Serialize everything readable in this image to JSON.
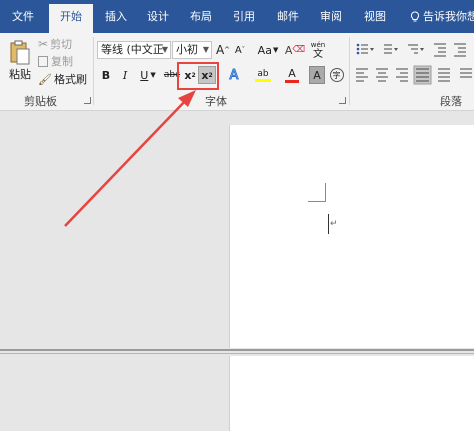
{
  "tabs": [
    {
      "label": "文件",
      "active": false
    },
    {
      "label": "开始",
      "active": true
    },
    {
      "label": "插入",
      "active": false
    },
    {
      "label": "设计",
      "active": false
    },
    {
      "label": "布局",
      "active": false
    },
    {
      "label": "引用",
      "active": false
    },
    {
      "label": "邮件",
      "active": false
    },
    {
      "label": "审阅",
      "active": false
    },
    {
      "label": "视图",
      "active": false
    }
  ],
  "tell_me": "告诉我你想",
  "clipboard": {
    "paste_label": "粘贴",
    "cut_label": "剪切",
    "copy_label": "复制",
    "format_painter_label": "格式刷",
    "group_label": "剪贴板"
  },
  "font": {
    "font_name": "等线 (中文正",
    "font_size": "小初",
    "grow_glyph": "A",
    "shrink_glyph": "A",
    "case_glyph": "Aa",
    "clear_glyph": "A",
    "phonetic_glyph": "wén",
    "bold_glyph": "B",
    "italic_glyph": "I",
    "underline_glyph": "U",
    "strike_glyph": "abc",
    "subscript_glyph": "x",
    "subscript_mark": "2",
    "superscript_glyph": "x",
    "superscript_mark": "2",
    "effects_glyph": "A",
    "highlight_glyph": "ab",
    "color_glyph": "A",
    "shading_glyph": "A",
    "enclose_glyph": "字",
    "group_label": "字体"
  },
  "paragraph": {
    "group_label": "段落"
  },
  "colors": {
    "accent": "#2b579a",
    "highlight_box": "#e8433f",
    "font_color": "#e8261d",
    "highlight_color": "#ffff00"
  }
}
